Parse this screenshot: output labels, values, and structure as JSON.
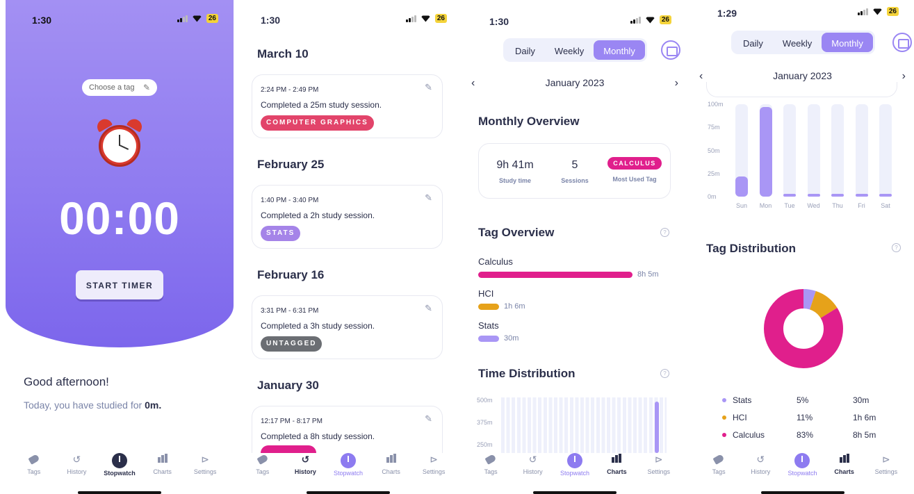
{
  "screen1": {
    "status_time": "1:30",
    "battery": "26",
    "tag_placeholder": "Choose a tag",
    "timer": "00:00",
    "start_label": "START TIMER",
    "greeting": "Good afternoon!",
    "studied_prefix": "Today, you have studied for ",
    "studied_value": "0m."
  },
  "screen2": {
    "status_time": "1:30",
    "battery": "26",
    "groups": [
      {
        "date": "March 10",
        "time": "2:24 PM - 2:49 PM",
        "desc": "Completed a 25m study session.",
        "tag": "COMPUTER GRAPHICS",
        "tag_color": "#e2446a"
      },
      {
        "date": "February 25",
        "time": "1:40 PM - 3:40 PM",
        "desc": "Completed a 2h study session.",
        "tag": "STATS",
        "tag_color": "#a584e8"
      },
      {
        "date": "February 16",
        "time": "3:31 PM - 6:31 PM",
        "desc": "Completed a 3h study session.",
        "tag": "UNTAGGED",
        "tag_color": "#6b6e73"
      },
      {
        "date": "January 30",
        "time": "12:17 PM - 8:17 PM",
        "desc": "Completed a 8h study session.",
        "tag": "",
        "tag_color": "#e01f8c"
      }
    ]
  },
  "screen3": {
    "status_time": "1:30",
    "battery": "26",
    "segments": [
      "Daily",
      "Weekly",
      "Monthly"
    ],
    "month": "January 2023",
    "overview_title": "Monthly Overview",
    "study_time": "9h 41m",
    "study_time_label": "Study time",
    "sessions": "5",
    "sessions_label": "Sessions",
    "most_used_tag": "CALCULUS",
    "most_used_label": "Most Used Tag",
    "tag_overview_title": "Tag Overview",
    "tags": [
      {
        "name": "Calculus",
        "value": "8h 5m",
        "minutes": 485,
        "color": "#e01f8c"
      },
      {
        "name": "HCI",
        "value": "1h 6m",
        "minutes": 66,
        "color": "#e6a21a"
      },
      {
        "name": "Stats",
        "value": "30m",
        "minutes": 30,
        "color": "#a996f5"
      }
    ],
    "time_dist_title": "Time Distribution",
    "time_dist_yticks": [
      "500m",
      "375m",
      "250m"
    ]
  },
  "screen4": {
    "status_time": "1:29",
    "battery": "26",
    "segments": [
      "Daily",
      "Weekly",
      "Monthly"
    ],
    "month": "January 2023",
    "tag_dist_title": "Tag Distribution",
    "chart_data": {
      "type": "bar",
      "categories": [
        "Sun",
        "Mon",
        "Tue",
        "Wed",
        "Thu",
        "Fri",
        "Sat"
      ],
      "values": [
        22,
        97,
        1,
        1,
        1,
        1,
        1
      ],
      "yticks": [
        "100m",
        "75m",
        "50m",
        "25m",
        "0m"
      ],
      "ylim": [
        0,
        100
      ]
    },
    "pie_data": {
      "type": "pie",
      "slices": [
        {
          "name": "Stats",
          "percent": "5%",
          "value": "30m",
          "share": 5,
          "color": "#a996f5"
        },
        {
          "name": "HCI",
          "percent": "11%",
          "value": "1h 6m",
          "share": 11,
          "color": "#e6a21a"
        },
        {
          "name": "Calculus",
          "percent": "83%",
          "value": "8h 5m",
          "share": 83,
          "color": "#e01f8c"
        }
      ]
    }
  },
  "tabbar": {
    "tags": "Tags",
    "history": "History",
    "stopwatch": "Stopwatch",
    "charts": "Charts",
    "settings": "Settings"
  }
}
